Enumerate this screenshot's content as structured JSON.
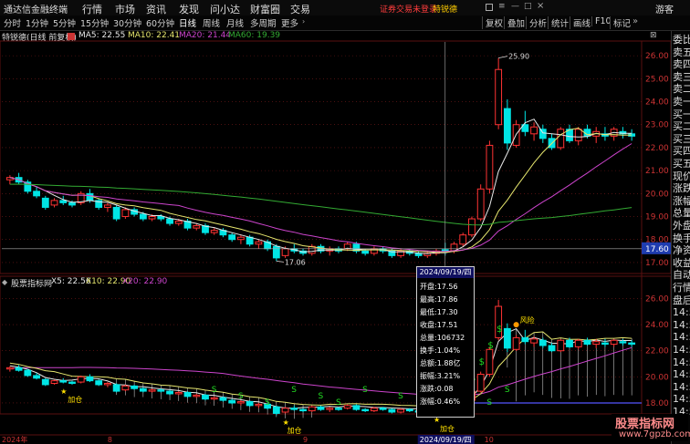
{
  "menubar": {
    "app_title": "通达信金融终端",
    "menus": [
      "行情",
      "市场",
      "资讯",
      "发现",
      "问小达",
      "财富圈",
      "交易"
    ],
    "alert": "证券交易未登录",
    "stock_name": "特锐德",
    "guest": "游客"
  },
  "toolbar": {
    "periods": [
      "分时",
      "1分钟",
      "5分钟",
      "15分钟",
      "30分钟",
      "60分钟",
      "日线",
      "周线",
      "月线",
      "多周期",
      "更多"
    ],
    "active_period": "日线",
    "right_tools": [
      "复权",
      "叠加",
      "分析",
      "统计",
      "画线",
      "F10",
      "标记"
    ]
  },
  "main_info": {
    "title": "特锐德(日线 前复权)",
    "ma5": "MA5: 22.55",
    "ma10": "MA10: 22.41",
    "ma20": "MA20: 21.44",
    "ma60": "MA60: 19.39"
  },
  "sub_info": {
    "title": "股票指标网",
    "x5": "X5: 22.56",
    "x10": "X10: 22.90",
    "x20": "X20: 22.90"
  },
  "colors": {
    "up": "#ff3333",
    "down": "#00e5e5",
    "ma5": "#e8e8e8",
    "ma10": "#e6e66e",
    "ma20": "#cc44cc",
    "ma60": "#33aa33",
    "grid": "#7a1a1a",
    "axis_text": "#cc3333"
  },
  "main_y_axis": [
    "26.00",
    "25.00",
    "24.00",
    "23.00",
    "22.00",
    "21.00",
    "20.00",
    "19.00",
    "18.00",
    "17.00"
  ],
  "current_price": "17.60",
  "sub_y_axis": [
    "26.00",
    "24.00",
    "22.00",
    "20.00",
    "18.00"
  ],
  "annotations": {
    "high": "25.90",
    "low": "17.06",
    "fengxian": "风险",
    "jiacang": "加仓",
    "s": "S",
    "dollar": "$"
  },
  "x_axis": {
    "year": "2024年",
    "m8": "8",
    "m9": "9",
    "date": "2024/09/19/四",
    "m10": "10"
  },
  "popup": {
    "date": "2024/09/19/四",
    "rows": [
      "开盘:17.56",
      "最高:17.86",
      "最低:17.30",
      "收盘:17.51",
      "总量:106732",
      "换手:1.04%",
      "总额:1.88亿",
      "振幅:3.21%",
      "涨跌:0.08",
      "涨幅:0.46%"
    ]
  },
  "side_panel": [
    "委比",
    "卖五",
    "卖四",
    "卖三",
    "卖二",
    "卖一",
    "买一",
    "买二",
    "买三",
    "买四",
    "买五",
    "现价",
    "涨跌",
    "涨幅",
    "总量",
    "外盘",
    "换手",
    "净资",
    "收益",
    "自动",
    "行情",
    "盘后",
    "14:5",
    "14:5",
    "14:5",
    "14:5",
    "14:5",
    "14:5",
    "14:5",
    "14:5",
    "14:5"
  ],
  "watermark": {
    "title": "股票指标网",
    "url": "www.7gpzb.com"
  },
  "chart_data": {
    "type": "candlestick",
    "y_range": [
      16.6,
      26.6
    ],
    "candles": [
      [
        20.6,
        20.8,
        20.4,
        20.7
      ],
      [
        20.7,
        20.9,
        20.4,
        20.5
      ],
      [
        20.5,
        20.6,
        20.0,
        20.1
      ],
      [
        20.1,
        20.3,
        19.8,
        19.9
      ],
      [
        19.8,
        19.9,
        19.3,
        19.4
      ],
      [
        19.5,
        19.8,
        19.4,
        19.7
      ],
      [
        19.7,
        19.9,
        19.5,
        19.6
      ],
      [
        19.6,
        19.7,
        19.4,
        19.5
      ],
      [
        19.6,
        20.1,
        19.5,
        20.0
      ],
      [
        20.0,
        20.2,
        19.6,
        19.7
      ],
      [
        19.7,
        19.8,
        19.3,
        19.4
      ],
      [
        19.4,
        19.6,
        19.2,
        19.5
      ],
      [
        19.4,
        19.5,
        18.8,
        18.9
      ],
      [
        19.0,
        19.4,
        18.9,
        19.3
      ],
      [
        19.3,
        19.4,
        19.0,
        19.1
      ],
      [
        19.1,
        19.2,
        18.8,
        18.9
      ],
      [
        18.9,
        19.1,
        18.8,
        19.0
      ],
      [
        19.0,
        19.1,
        18.8,
        18.9
      ],
      [
        18.9,
        19.0,
        18.6,
        18.7
      ],
      [
        18.7,
        18.9,
        18.6,
        18.8
      ],
      [
        18.8,
        18.9,
        18.4,
        18.5
      ],
      [
        18.5,
        18.7,
        18.4,
        18.6
      ],
      [
        18.6,
        18.7,
        18.2,
        18.3
      ],
      [
        18.3,
        18.5,
        18.2,
        18.4
      ],
      [
        18.4,
        18.5,
        18.1,
        18.2
      ],
      [
        18.2,
        18.3,
        17.9,
        18.0
      ],
      [
        18.0,
        18.2,
        17.8,
        18.1
      ],
      [
        18.1,
        18.2,
        17.7,
        17.8
      ],
      [
        17.8,
        18.0,
        17.6,
        17.9
      ],
      [
        17.9,
        18.0,
        17.5,
        17.6
      ],
      [
        17.7,
        17.8,
        17.06,
        17.2
      ],
      [
        17.3,
        17.7,
        17.2,
        17.6
      ],
      [
        17.6,
        17.8,
        17.4,
        17.5
      ],
      [
        17.5,
        17.6,
        17.3,
        17.4
      ],
      [
        17.4,
        17.8,
        17.3,
        17.7
      ],
      [
        17.7,
        17.8,
        17.4,
        17.5
      ],
      [
        17.5,
        17.7,
        17.3,
        17.6
      ],
      [
        17.6,
        17.7,
        17.4,
        17.5
      ],
      [
        17.6,
        17.9,
        17.5,
        17.8
      ],
      [
        17.8,
        17.9,
        17.4,
        17.5
      ],
      [
        17.5,
        17.6,
        17.3,
        17.4
      ],
      [
        17.4,
        17.7,
        17.3,
        17.6
      ],
      [
        17.6,
        17.7,
        17.4,
        17.5
      ],
      [
        17.5,
        17.6,
        17.2,
        17.3
      ],
      [
        17.3,
        17.6,
        17.2,
        17.5
      ],
      [
        17.5,
        17.6,
        17.3,
        17.4
      ],
      [
        17.4,
        17.5,
        17.2,
        17.3
      ],
      [
        17.3,
        17.5,
        17.2,
        17.4
      ],
      [
        17.4,
        17.6,
        17.3,
        17.5
      ],
      [
        17.56,
        17.86,
        17.3,
        17.51
      ],
      [
        17.5,
        17.9,
        17.4,
        17.8
      ],
      [
        17.8,
        18.3,
        17.7,
        18.2
      ],
      [
        18.2,
        19.0,
        18.1,
        18.9
      ],
      [
        18.9,
        20.4,
        18.8,
        20.2
      ],
      [
        20.2,
        22.3,
        20.0,
        22.1
      ],
      [
        23.0,
        25.9,
        22.8,
        25.4
      ],
      [
        23.7,
        24.1,
        21.9,
        22.2
      ],
      [
        22.1,
        23.2,
        22.0,
        23.0
      ],
      [
        23.0,
        23.6,
        22.5,
        22.7
      ],
      [
        22.6,
        23.1,
        22.3,
        22.9
      ],
      [
        22.8,
        23.0,
        22.2,
        22.4
      ],
      [
        22.4,
        22.6,
        21.9,
        22.0
      ],
      [
        22.0,
        22.9,
        21.9,
        22.8
      ],
      [
        22.8,
        23.0,
        22.2,
        22.3
      ],
      [
        22.3,
        22.9,
        22.1,
        22.8
      ],
      [
        22.8,
        23.0,
        22.4,
        22.5
      ],
      [
        22.5,
        22.9,
        22.2,
        22.7
      ],
      [
        22.6,
        22.9,
        22.3,
        22.5
      ],
      [
        22.5,
        22.9,
        22.3,
        22.8
      ],
      [
        22.7,
        22.9,
        22.4,
        22.6
      ],
      [
        22.6,
        22.8,
        22.3,
        22.5
      ]
    ]
  }
}
